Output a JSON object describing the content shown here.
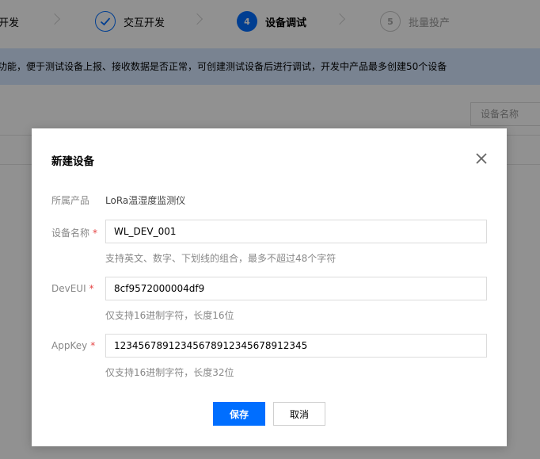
{
  "steps": [
    {
      "number": "",
      "label": "开发",
      "state": "done"
    },
    {
      "number": "",
      "label": "交互开发",
      "state": "done"
    },
    {
      "number": "4",
      "label": "设备调试",
      "state": "active"
    },
    {
      "number": "5",
      "label": "批量投产",
      "state": "todo"
    }
  ],
  "notice": {
    "text": "功能，便于测试设备上报、接收数据是否正常，可创建测试设备后进行调试，开发中产品最多创建50个设备"
  },
  "search": {
    "placeholder": "设备名称"
  },
  "dialog": {
    "title": "新建设备",
    "product": {
      "label": "所属产品",
      "value": "LoRa温湿度监测仪"
    },
    "device_name": {
      "label": "设备名称",
      "required_mark": "*",
      "value": "WL_DEV_001",
      "hint": "支持英文、数字、下划线的组合，最多不超过48个字符"
    },
    "dev_eui": {
      "label": "DevEUI",
      "required_mark": "*",
      "value": "8cf9572000004df9",
      "hint": "仅支持16进制字符，长度16位"
    },
    "app_key": {
      "label": "AppKey",
      "required_mark": "*",
      "value": "12345678912345678912345678912345",
      "hint": "仅支持16进制字符，长度32位"
    },
    "save_label": "保存",
    "cancel_label": "取消"
  },
  "colors": {
    "primary": "#006eff",
    "notice_bg": "#d5e7ff",
    "required": "#e54545"
  },
  "icons": {
    "done_step": "check-icon",
    "close": "close-icon",
    "separator": "chevron-right-icon"
  }
}
